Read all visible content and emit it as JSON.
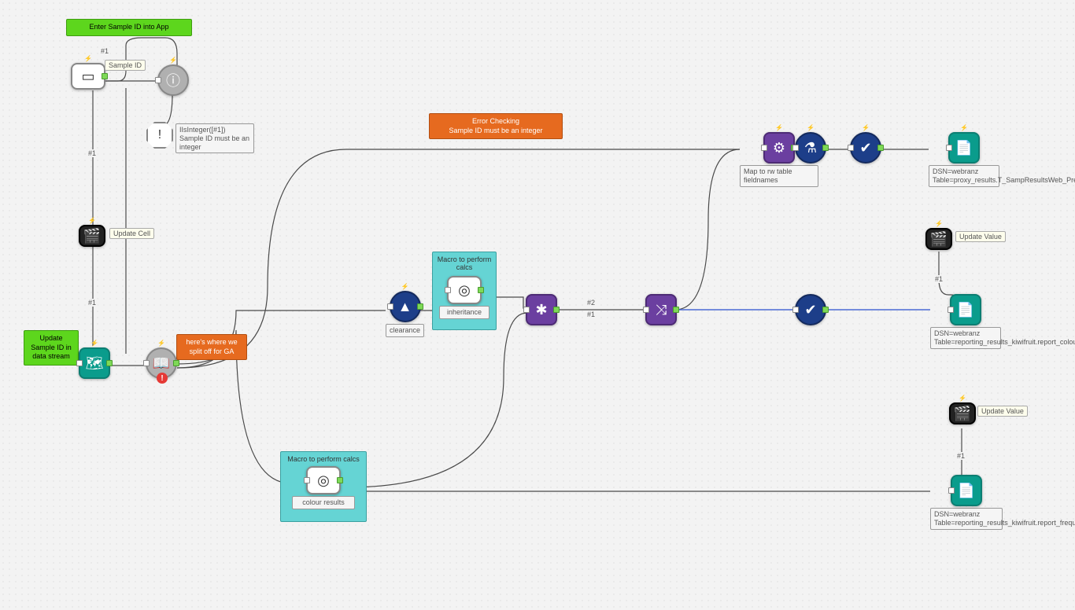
{
  "annotations": {
    "enter_sample": "Enter Sample ID into App",
    "update_sample": "Update Sample ID in data stream",
    "split_ga": "here's where we split off for GA",
    "error_check": "Error Checking\nSample ID must be an integer"
  },
  "labels": {
    "sample_id": "Sample ID",
    "update_cell": "Update Cell",
    "update_value_1": "Update Value",
    "update_value_2": "Update Value",
    "clearance": "clearance",
    "inheritance": "inheritance",
    "colour_results": "colour results",
    "map_fieldnames": "Map to rw table fieldnames",
    "wire_num1": "#1",
    "wire_num2": "#2"
  },
  "containers": {
    "macro_calcs_1": "Macro to perform calcs",
    "macro_calcs_2": "Macro to perform calcs"
  },
  "outputs": {
    "out1": "DSN=webranz\nTable=proxy_results.T_SampResultsWeb_Pre",
    "out2": "DSN=webranz\nTable=reporting_results_kiwifruit.report_colour",
    "out3": "DSN=webranz\nTable=reporting_results_kiwifruit.report_frequency_graphs"
  },
  "tooltips": {
    "isinteger": "IIsInteger([#1])\nSample ID must be an integer"
  },
  "colors": {
    "green": "#5dd61d",
    "orange": "#e66a1f",
    "teal": "#0a9c8c",
    "purple": "#6b3fa0",
    "navy": "#1d3e89",
    "cyan": "#65d4d4"
  }
}
